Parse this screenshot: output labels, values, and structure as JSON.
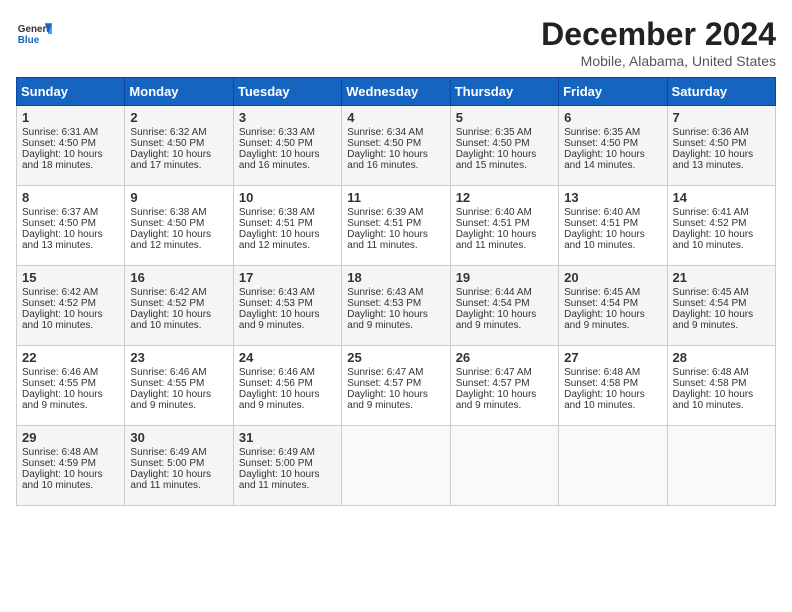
{
  "header": {
    "logo_general": "General",
    "logo_blue": "Blue",
    "month_title": "December 2024",
    "location": "Mobile, Alabama, United States"
  },
  "days_of_week": [
    "Sunday",
    "Monday",
    "Tuesday",
    "Wednesday",
    "Thursday",
    "Friday",
    "Saturday"
  ],
  "weeks": [
    [
      {
        "day": "1",
        "info": "Sunrise: 6:31 AM\nSunset: 4:50 PM\nDaylight: 10 hours\nand 18 minutes."
      },
      {
        "day": "2",
        "info": "Sunrise: 6:32 AM\nSunset: 4:50 PM\nDaylight: 10 hours\nand 17 minutes."
      },
      {
        "day": "3",
        "info": "Sunrise: 6:33 AM\nSunset: 4:50 PM\nDaylight: 10 hours\nand 16 minutes."
      },
      {
        "day": "4",
        "info": "Sunrise: 6:34 AM\nSunset: 4:50 PM\nDaylight: 10 hours\nand 16 minutes."
      },
      {
        "day": "5",
        "info": "Sunrise: 6:35 AM\nSunset: 4:50 PM\nDaylight: 10 hours\nand 15 minutes."
      },
      {
        "day": "6",
        "info": "Sunrise: 6:35 AM\nSunset: 4:50 PM\nDaylight: 10 hours\nand 14 minutes."
      },
      {
        "day": "7",
        "info": "Sunrise: 6:36 AM\nSunset: 4:50 PM\nDaylight: 10 hours\nand 13 minutes."
      }
    ],
    [
      {
        "day": "8",
        "info": "Sunrise: 6:37 AM\nSunset: 4:50 PM\nDaylight: 10 hours\nand 13 minutes."
      },
      {
        "day": "9",
        "info": "Sunrise: 6:38 AM\nSunset: 4:50 PM\nDaylight: 10 hours\nand 12 minutes."
      },
      {
        "day": "10",
        "info": "Sunrise: 6:38 AM\nSunset: 4:51 PM\nDaylight: 10 hours\nand 12 minutes."
      },
      {
        "day": "11",
        "info": "Sunrise: 6:39 AM\nSunset: 4:51 PM\nDaylight: 10 hours\nand 11 minutes."
      },
      {
        "day": "12",
        "info": "Sunrise: 6:40 AM\nSunset: 4:51 PM\nDaylight: 10 hours\nand 11 minutes."
      },
      {
        "day": "13",
        "info": "Sunrise: 6:40 AM\nSunset: 4:51 PM\nDaylight: 10 hours\nand 10 minutes."
      },
      {
        "day": "14",
        "info": "Sunrise: 6:41 AM\nSunset: 4:52 PM\nDaylight: 10 hours\nand 10 minutes."
      }
    ],
    [
      {
        "day": "15",
        "info": "Sunrise: 6:42 AM\nSunset: 4:52 PM\nDaylight: 10 hours\nand 10 minutes."
      },
      {
        "day": "16",
        "info": "Sunrise: 6:42 AM\nSunset: 4:52 PM\nDaylight: 10 hours\nand 10 minutes."
      },
      {
        "day": "17",
        "info": "Sunrise: 6:43 AM\nSunset: 4:53 PM\nDaylight: 10 hours\nand 9 minutes."
      },
      {
        "day": "18",
        "info": "Sunrise: 6:43 AM\nSunset: 4:53 PM\nDaylight: 10 hours\nand 9 minutes."
      },
      {
        "day": "19",
        "info": "Sunrise: 6:44 AM\nSunset: 4:54 PM\nDaylight: 10 hours\nand 9 minutes."
      },
      {
        "day": "20",
        "info": "Sunrise: 6:45 AM\nSunset: 4:54 PM\nDaylight: 10 hours\nand 9 minutes."
      },
      {
        "day": "21",
        "info": "Sunrise: 6:45 AM\nSunset: 4:54 PM\nDaylight: 10 hours\nand 9 minutes."
      }
    ],
    [
      {
        "day": "22",
        "info": "Sunrise: 6:46 AM\nSunset: 4:55 PM\nDaylight: 10 hours\nand 9 minutes."
      },
      {
        "day": "23",
        "info": "Sunrise: 6:46 AM\nSunset: 4:55 PM\nDaylight: 10 hours\nand 9 minutes."
      },
      {
        "day": "24",
        "info": "Sunrise: 6:46 AM\nSunset: 4:56 PM\nDaylight: 10 hours\nand 9 minutes."
      },
      {
        "day": "25",
        "info": "Sunrise: 6:47 AM\nSunset: 4:57 PM\nDaylight: 10 hours\nand 9 minutes."
      },
      {
        "day": "26",
        "info": "Sunrise: 6:47 AM\nSunset: 4:57 PM\nDaylight: 10 hours\nand 9 minutes."
      },
      {
        "day": "27",
        "info": "Sunrise: 6:48 AM\nSunset: 4:58 PM\nDaylight: 10 hours\nand 10 minutes."
      },
      {
        "day": "28",
        "info": "Sunrise: 6:48 AM\nSunset: 4:58 PM\nDaylight: 10 hours\nand 10 minutes."
      }
    ],
    [
      {
        "day": "29",
        "info": "Sunrise: 6:48 AM\nSunset: 4:59 PM\nDaylight: 10 hours\nand 10 minutes."
      },
      {
        "day": "30",
        "info": "Sunrise: 6:49 AM\nSunset: 5:00 PM\nDaylight: 10 hours\nand 11 minutes."
      },
      {
        "day": "31",
        "info": "Sunrise: 6:49 AM\nSunset: 5:00 PM\nDaylight: 10 hours\nand 11 minutes."
      },
      {
        "day": "",
        "info": ""
      },
      {
        "day": "",
        "info": ""
      },
      {
        "day": "",
        "info": ""
      },
      {
        "day": "",
        "info": ""
      }
    ]
  ]
}
